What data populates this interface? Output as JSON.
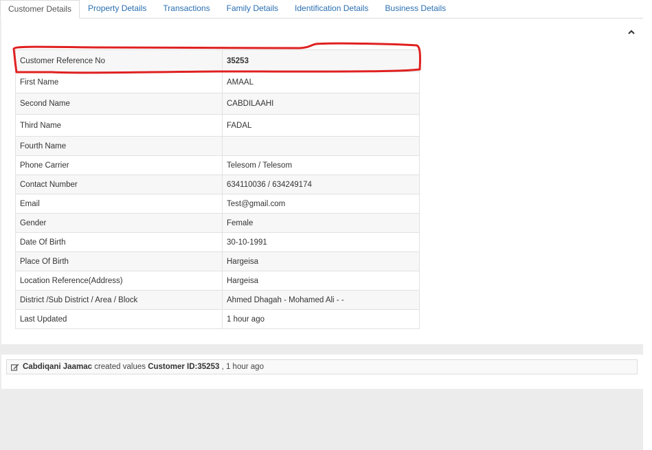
{
  "tabs": [
    {
      "label": "Customer Details",
      "active": true
    },
    {
      "label": "Property Details",
      "active": false
    },
    {
      "label": "Transactions",
      "active": false
    },
    {
      "label": "Family Details",
      "active": false
    },
    {
      "label": "Identification Details",
      "active": false
    },
    {
      "label": "Business Details",
      "active": false
    }
  ],
  "collapse_icon": "chevron-up-icon",
  "customer_details": {
    "rows": [
      {
        "label": "Customer Reference No",
        "value": "35253"
      },
      {
        "label": "First Name",
        "value": "AMAAL"
      },
      {
        "label": "Second Name",
        "value": "CABDILAAHI"
      },
      {
        "label": "Third Name",
        "value": "FADAL"
      },
      {
        "label": "Fourth Name",
        "value": ""
      },
      {
        "label": "Phone Carrier",
        "value": "Telesom / Telesom"
      },
      {
        "label": "Contact Number",
        "value": "634110036 / 634249174"
      },
      {
        "label": "Email",
        "value": "Test@gmail.com"
      },
      {
        "label": "Gender",
        "value": "Female"
      },
      {
        "label": "Date Of Birth",
        "value": "30-10-1991"
      },
      {
        "label": "Place Of Birth",
        "value": "Hargeisa"
      },
      {
        "label": "Location Reference(Address)",
        "value": "Hargeisa"
      },
      {
        "label": "District /Sub District / Area / Block",
        "value": "Ahmed Dhagah - Mohamed Ali - -"
      },
      {
        "label": "Last Updated",
        "value": "1 hour ago"
      }
    ]
  },
  "highlight_color": "#e02020",
  "activity": {
    "user": "Cabdiqani Jaamac",
    "action": "created values",
    "target": "Customer ID:35253",
    "time": ", 1 hour ago"
  }
}
